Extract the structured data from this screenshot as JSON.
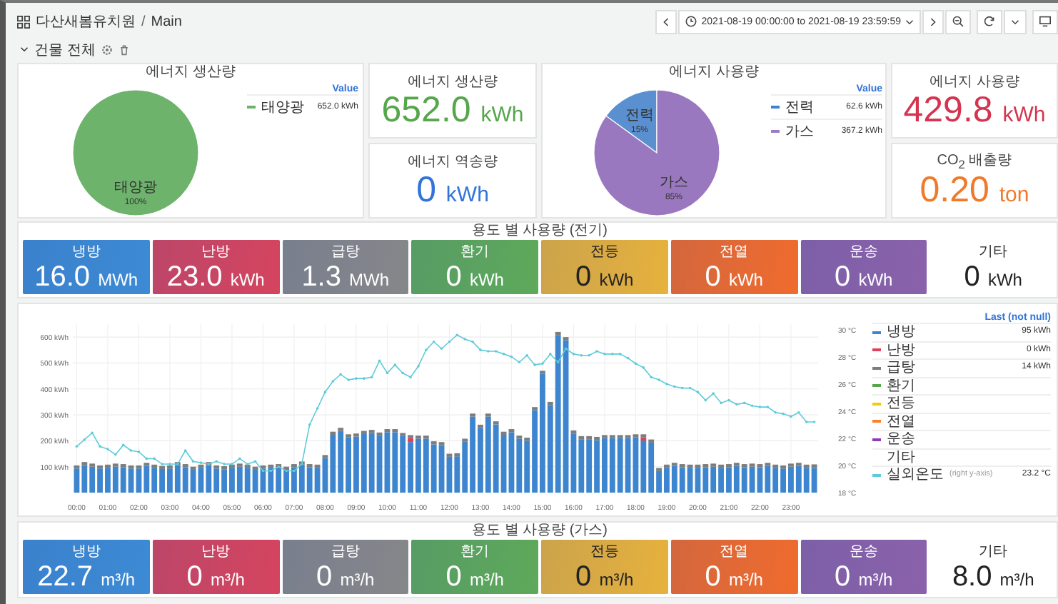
{
  "header": {
    "title": "다산새봄유치원",
    "separator": "/",
    "page": "Main",
    "time_range": "2021-08-19 00:00:00 to 2021-08-19 23:59:59"
  },
  "row": {
    "title": "건물 전체",
    "expanded": true
  },
  "production_pie": {
    "title": "에너지 생산량",
    "legend_header": "Value",
    "legend": [
      {
        "name": "태양광",
        "value": "652.0 kWh",
        "color": "#6db36c"
      }
    ],
    "slice": {
      "name": "태양광",
      "percent": "100%",
      "color": "#6db36c"
    }
  },
  "production_stats": [
    {
      "title": "에너지 생산량",
      "value": "652.0",
      "unit": "kWh",
      "color": "#56a64b"
    },
    {
      "title": "에너지 역송량",
      "value": "0",
      "unit": "kWh",
      "color": "#3274d9"
    }
  ],
  "usage_pie": {
    "title": "에너지 사용량",
    "legend_header": "Value",
    "legend": [
      {
        "name": "전력",
        "value": "62.6 kWh",
        "color": "#3f80d0"
      },
      {
        "name": "가스",
        "value": "367.2 kWh",
        "color": "#9b7cc2"
      }
    ],
    "chart_data": {
      "type": "pie",
      "categories": [
        "전력",
        "가스"
      ],
      "values": [
        15,
        85
      ],
      "value_labels": [
        "15%",
        "85%"
      ],
      "colors": [
        "#5a90cf",
        "#9a78bf"
      ]
    }
  },
  "usage_stats": [
    {
      "title": "에너지 사용량",
      "value": "429.8",
      "unit": "kWh",
      "color": "#d4344f"
    },
    {
      "title": "CO$_{2}$ 배출량",
      "value": "0.20",
      "unit": "ton",
      "color": "#f07a2b"
    }
  ],
  "electric": {
    "title": "용도 별 사용량 (전기)",
    "tiles": [
      {
        "label": "냉방",
        "value": "16.0",
        "unit": "MWh",
        "color": "#3d8ad4",
        "dark": false
      },
      {
        "label": "난방",
        "value": "23.0",
        "unit": "kWh",
        "color": "#d5445f",
        "dark": false
      },
      {
        "label": "급탕",
        "value": "1.3",
        "unit": "MWh",
        "color": "#86878a",
        "dark": false
      },
      {
        "label": "환기",
        "value": "0",
        "unit": "kWh",
        "color": "#5ea95a",
        "dark": false
      },
      {
        "label": "전등",
        "value": "0",
        "unit": "kWh",
        "color": "#e7b23c",
        "dark": true
      },
      {
        "label": "전열",
        "value": "0",
        "unit": "kWh",
        "color": "#f06b2c",
        "dark": false
      },
      {
        "label": "운송",
        "value": "0",
        "unit": "kWh",
        "color": "#8a62aa",
        "dark": false
      },
      {
        "label": "기타",
        "value": "0",
        "unit": "kWh",
        "dark": true
      }
    ]
  },
  "usage_chart": {
    "legend_header": "Last (not null)",
    "series_legend": [
      {
        "value": "95 kWh"
      },
      {
        "value": "0 kWh"
      },
      {
        "value": "14 kWh"
      },
      {
        "note": "(right y-axis)",
        "value": "23.2 °C"
      }
    ],
    "extra_legend": [
      {
        "name": "환기",
        "color": "#56a64b"
      },
      {
        "name": "전등",
        "color": "#f2cc0c"
      },
      {
        "name": "전열",
        "color": "#ff7f2a"
      },
      {
        "name": "운송",
        "color": "#8f3bb8"
      },
      {
        "name": "기타"
      }
    ],
    "chart_data": {
      "type": "bar",
      "stacked": true,
      "grid": true,
      "x": [
        0,
        0.25,
        0.5,
        0.75,
        1,
        1.25,
        1.5,
        1.75,
        2,
        2.25,
        2.5,
        2.75,
        3,
        3.25,
        3.5,
        3.75,
        4,
        4.25,
        4.5,
        4.75,
        5,
        5.25,
        5.5,
        5.75,
        6,
        6.25,
        6.5,
        6.75,
        7,
        7.25,
        7.5,
        7.75,
        8,
        8.25,
        8.5,
        8.75,
        9,
        9.25,
        9.5,
        9.75,
        10,
        10.25,
        10.5,
        10.75,
        11,
        11.25,
        11.5,
        11.75,
        12,
        12.25,
        12.5,
        12.75,
        13,
        13.25,
        13.5,
        13.75,
        14,
        14.25,
        14.5,
        14.75,
        15,
        15.25,
        15.5,
        15.75,
        16,
        16.25,
        16.5,
        16.75,
        17,
        17.25,
        17.5,
        17.75,
        18,
        18.25,
        18.5,
        18.75,
        19,
        19.25,
        19.5,
        19.75,
        20,
        20.25,
        20.5,
        20.75,
        21,
        21.25,
        21.5,
        21.75,
        22,
        22.25,
        22.5,
        22.75,
        23,
        23.25,
        23.5,
        23.75
      ],
      "xlim": [
        -0.125,
        23.875
      ],
      "xticks": [
        {
          "value": 0,
          "label": "00:00"
        },
        {
          "value": 1,
          "label": "01:00"
        },
        {
          "value": 2,
          "label": "02:00"
        },
        {
          "value": 3,
          "label": "03:00"
        },
        {
          "value": 4,
          "label": "04:00"
        },
        {
          "value": 5,
          "label": "05:00"
        },
        {
          "value": 6,
          "label": "06:00"
        },
        {
          "value": 7,
          "label": "07:00"
        },
        {
          "value": 8,
          "label": "08:00"
        },
        {
          "value": 9,
          "label": "09:00"
        },
        {
          "value": 10,
          "label": "10:00"
        },
        {
          "value": 11,
          "label": "11:00"
        },
        {
          "value": 12,
          "label": "12:00"
        },
        {
          "value": 13,
          "label": "13:00"
        },
        {
          "value": 14,
          "label": "14:00"
        },
        {
          "value": 15,
          "label": "15:00"
        },
        {
          "value": 16,
          "label": "16:00"
        },
        {
          "value": 17,
          "label": "17:00"
        },
        {
          "value": 18,
          "label": "18:00"
        },
        {
          "value": 19,
          "label": "19:00"
        },
        {
          "value": 20,
          "label": "20:00"
        },
        {
          "value": 21,
          "label": "21:00"
        },
        {
          "value": 22,
          "label": "22:00"
        },
        {
          "value": 23,
          "label": "23:00"
        }
      ],
      "ylim": [
        0,
        650
      ],
      "yticks": [
        {
          "value": 100,
          "label": "100 kWh"
        },
        {
          "value": 200,
          "label": "200 kWh"
        },
        {
          "value": 300,
          "label": "300 kWh"
        },
        {
          "value": 400,
          "label": "400 kWh"
        },
        {
          "value": 500,
          "label": "500 kWh"
        },
        {
          "value": 600,
          "label": "600 kWh"
        }
      ],
      "y2lim": [
        18,
        30.4
      ],
      "y2ticks": [
        {
          "value": 18,
          "label": "18 °C"
        },
        {
          "value": 20,
          "label": "20 °C"
        },
        {
          "value": 22,
          "label": "22 °C"
        },
        {
          "value": 24,
          "label": "24 °C"
        },
        {
          "value": 26,
          "label": "26 °C"
        },
        {
          "value": 28,
          "label": "28 °C"
        },
        {
          "value": 30,
          "label": "30 °C"
        }
      ],
      "series": [
        {
          "name": "냉방",
          "color": "#3d86cf",
          "values": [
            93,
            106,
            100,
            93,
            96,
            100,
            98,
            93,
            93,
            103,
            96,
            91,
            93,
            106,
            98,
            88,
            96,
            106,
            93,
            90,
            96,
            100,
            96,
            88,
            93,
            96,
            98,
            88,
            98,
            108,
            98,
            96,
            133,
            223,
            238,
            213,
            216,
            226,
            230,
            220,
            233,
            233,
            218,
            195,
            208,
            208,
            186,
            183,
            138,
            140,
            196,
            293,
            250,
            293,
            263,
            223,
            233,
            208,
            200,
            318,
            458,
            338,
            608,
            588,
            228,
            206,
            206,
            203,
            210,
            210,
            210,
            210,
            213,
            201,
            193,
            83,
            96,
            103,
            98,
            96,
            96,
            98,
            100,
            96,
            98,
            103,
            98,
            100,
            98,
            103,
            96,
            93,
            100,
            103,
            96,
            95
          ]
        },
        {
          "name": "난방",
          "color": "#e0405a",
          "values": [
            null,
            null,
            null,
            null,
            null,
            null,
            null,
            null,
            null,
            null,
            null,
            null,
            null,
            null,
            null,
            null,
            null,
            null,
            null,
            null,
            null,
            null,
            null,
            null,
            null,
            null,
            null,
            null,
            null,
            null,
            null,
            null,
            null,
            null,
            null,
            null,
            null,
            null,
            null,
            null,
            null,
            null,
            null,
            15,
            null,
            null,
            null,
            null,
            null,
            null,
            null,
            null,
            null,
            null,
            null,
            null,
            null,
            null,
            null,
            null,
            null,
            null,
            null,
            null,
            null,
            null,
            null,
            null,
            null,
            null,
            null,
            null,
            null,
            12,
            null,
            null,
            null,
            null,
            null,
            null,
            null,
            null,
            null,
            null,
            null,
            null,
            null,
            null,
            null,
            null,
            null,
            null,
            null,
            null,
            null,
            null
          ]
        },
        {
          "name": "급탕",
          "color": "#7d7d7d",
          "values": [
            12,
            12,
            12,
            12,
            12,
            12,
            12,
            12,
            12,
            12,
            12,
            12,
            12,
            12,
            12,
            12,
            12,
            12,
            12,
            12,
            12,
            12,
            12,
            12,
            12,
            12,
            12,
            12,
            12,
            12,
            12,
            12,
            12,
            12,
            12,
            12,
            12,
            12,
            12,
            12,
            12,
            12,
            12,
            12,
            12,
            12,
            12,
            12,
            12,
            12,
            12,
            12,
            12,
            12,
            12,
            12,
            12,
            12,
            12,
            12,
            12,
            12,
            12,
            12,
            12,
            12,
            12,
            12,
            12,
            12,
            12,
            12,
            12,
            12,
            12,
            12,
            12,
            12,
            12,
            12,
            12,
            12,
            12,
            12,
            12,
            12,
            12,
            12,
            12,
            12,
            12,
            12,
            12,
            12,
            12,
            14
          ]
        },
        {
          "name": "실외온도",
          "color": "#5ecbd9",
          "type": "line",
          "axis": "y2",
          "values": [
            21.4,
            21.9,
            22.4,
            21.4,
            21.2,
            20.8,
            21.5,
            21.1,
            21.0,
            20.5,
            20.5,
            20.1,
            20.1,
            20.1,
            21.1,
            20.3,
            20.2,
            20.1,
            20.3,
            20.1,
            20.1,
            20.5,
            20.1,
            20.3,
            19.6,
            19.6,
            19.9,
            19.6,
            19.6,
            20.1,
            23.0,
            24.2,
            25.4,
            26.2,
            26.7,
            26.3,
            26.4,
            26.4,
            26.5,
            27.7,
            26.8,
            27.4,
            26.8,
            26.5,
            27.3,
            28.5,
            29.1,
            28.6,
            29.1,
            29.6,
            29.3,
            29.1,
            28.5,
            28.4,
            28.4,
            28.2,
            28.0,
            27.6,
            28.1,
            27.4,
            27.5,
            28.2,
            27.6,
            28.6,
            28.2,
            28.1,
            28.1,
            28.4,
            28.2,
            28.2,
            28.2,
            27.9,
            27.5,
            27.2,
            26.5,
            26.3,
            26.0,
            25.8,
            25.7,
            25.7,
            25.4,
            24.8,
            25.3,
            24.6,
            24.8,
            24.5,
            24.6,
            24.4,
            24.3,
            24.3,
            23.9,
            23.8,
            23.6,
            23.9,
            23.2,
            23.2
          ]
        }
      ]
    }
  },
  "gas": {
    "title": "용도 별 사용량 (가스)",
    "tiles": [
      {
        "label": "냉방",
        "value": "22.7",
        "unit": "m³/h",
        "color": "#3d8ad4",
        "dark": false
      },
      {
        "label": "난방",
        "value": "0",
        "unit": "m³/h",
        "color": "#d5445f",
        "dark": false
      },
      {
        "label": "급탕",
        "value": "0",
        "unit": "m³/h",
        "color": "#86878a",
        "dark": false
      },
      {
        "label": "환기",
        "value": "0",
        "unit": "m³/h",
        "color": "#5ea95a",
        "dark": false
      },
      {
        "label": "전등",
        "value": "0",
        "unit": "m³/h",
        "color": "#e7b23c",
        "dark": true
      },
      {
        "label": "전열",
        "value": "0",
        "unit": "m³/h",
        "color": "#f06b2c",
        "dark": false
      },
      {
        "label": "운송",
        "value": "0",
        "unit": "m³/h",
        "color": "#8a62aa",
        "dark": false
      },
      {
        "label": "기타",
        "value": "8.0",
        "unit": "m³/h",
        "dark": true
      }
    ]
  }
}
